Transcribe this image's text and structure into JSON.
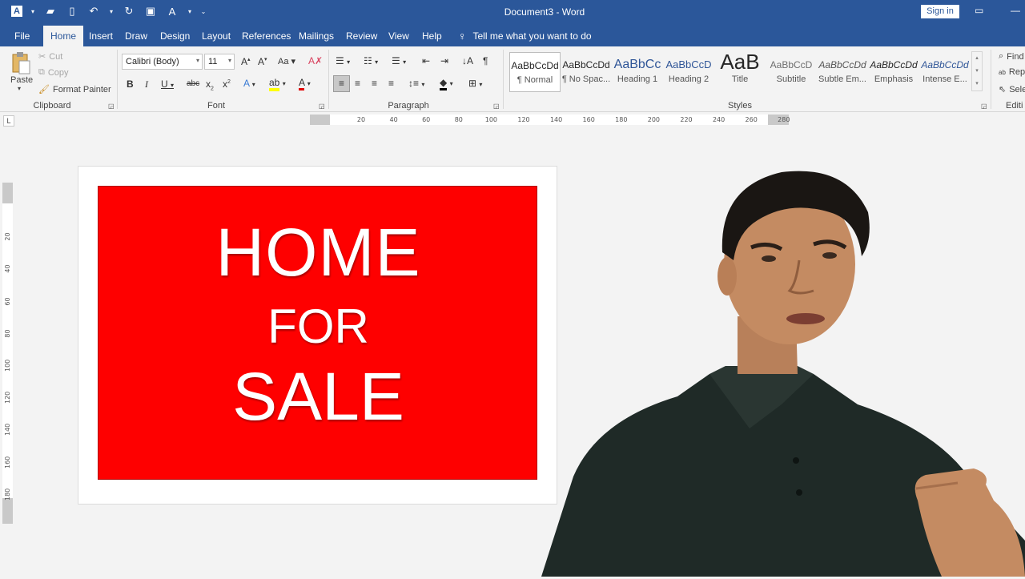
{
  "titlebar": {
    "doc_title": "Document3 - Word",
    "signin": "Sign in"
  },
  "tabs": [
    "File",
    "Home",
    "Insert",
    "Draw",
    "Design",
    "Layout",
    "References",
    "Mailings",
    "Review",
    "View",
    "Help"
  ],
  "active_tab": "Home",
  "tellme": "Tell me what you want to do",
  "clipboard": {
    "paste": "Paste",
    "cut": "Cut",
    "copy": "Copy",
    "format_painter": "Format Painter",
    "label": "Clipboard"
  },
  "font": {
    "name": "Calibri (Body)",
    "size": "11",
    "label": "Font"
  },
  "paragraph": {
    "label": "Paragraph"
  },
  "styles": {
    "label": "Styles",
    "items": [
      {
        "preview": "AaBbCcDd",
        "name": "¶ Normal"
      },
      {
        "preview": "AaBbCcDd",
        "name": "¶ No Spac..."
      },
      {
        "preview": "AaBbCc",
        "name": "Heading 1"
      },
      {
        "preview": "AaBbCcD",
        "name": "Heading 2"
      },
      {
        "preview": "AaB",
        "name": "Title"
      },
      {
        "preview": "AaBbCcD",
        "name": "Subtitle"
      },
      {
        "preview": "AaBbCcDd",
        "name": "Subtle Em..."
      },
      {
        "preview": "AaBbCcDd",
        "name": "Emphasis"
      },
      {
        "preview": "AaBbCcDd",
        "name": "Intense E..."
      }
    ]
  },
  "editing": {
    "find": "Find",
    "replace": "Rep",
    "select": "Sele",
    "label": "Editi"
  },
  "ruler": {
    "h_ticks": [
      "20",
      "40",
      "60",
      "80",
      "100",
      "120",
      "140",
      "160",
      "180",
      "200",
      "220",
      "240",
      "260",
      "280"
    ],
    "v_ticks": [
      "20",
      "40",
      "60",
      "80",
      "100",
      "120",
      "140",
      "160",
      "180"
    ]
  },
  "sign": {
    "line1": "HOME",
    "line2": "FOR",
    "line3": "SALE",
    "color": "#fe0000"
  },
  "colors": {
    "word_blue": "#2b579a",
    "ribbon_bg": "#f3f3f3"
  }
}
